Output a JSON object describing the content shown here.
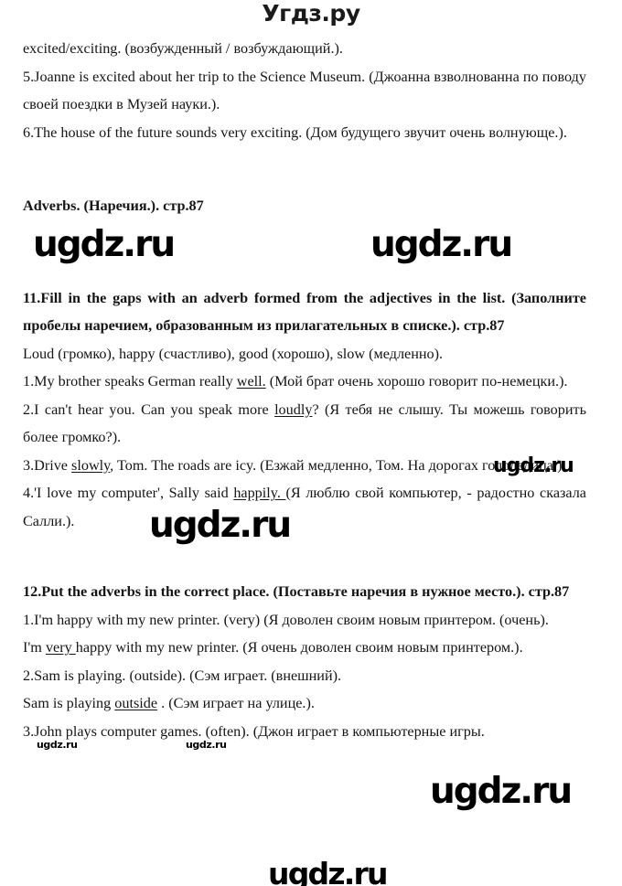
{
  "site": {
    "header_logo": "Угдз.ру",
    "watermark_text": "ugdz.ru"
  },
  "page": {
    "page_reference": "стр.87"
  },
  "watermarks": [
    {
      "id": "wm1",
      "text": "ugdz.ru",
      "size": "xl"
    },
    {
      "id": "wm2",
      "text": "ugdz.ru",
      "size": "xl"
    },
    {
      "id": "wm3",
      "text": "ugdz.ru",
      "size": "md"
    },
    {
      "id": "wm4",
      "text": "ugdz.ru",
      "size": "xl"
    },
    {
      "id": "wm5",
      "text": "ugdz.ru",
      "size": "sm"
    },
    {
      "id": "wm6",
      "text": "ugdz.ru",
      "size": "sm"
    },
    {
      "id": "wm7",
      "text": "ugdz.ru",
      "size": "xl"
    },
    {
      "id": "wm8",
      "text": "ugdz.ru",
      "size": "lg"
    }
  ],
  "content": {
    "intro_line": "excited/exciting. (возбужденный / возбуждающий.).",
    "ex10_items": [
      "5.Joanne is excited about her trip to the Science Museum. (Джоанна взволнованна по поводу своей поездки в Музей науки.).",
      "6.The house of the future sounds very exciting. (Дом будущего звучит очень волнующе.)."
    ],
    "section_heading": "Adverbs. (Наречия.). стр.87",
    "ex11": {
      "title": "11.Fill in the gaps with an adverb formed from the adjectives in the list. (Заполните пробелы наречием, образованным из прилагательных в списке.). стр.87",
      "word_bank": "Loud (громко), happy (счастливо), good (хорошо), slow (медленно).",
      "items": [
        {
          "before": "1.My brother speaks German really ",
          "answer": "well.",
          "after": " (Мой брат очень хорошо говорит по-немецки.)."
        },
        {
          "before": "2.I can't hear you. Can you speak more ",
          "answer": "loudly",
          "after": "? (Я тебя не слышу. Ты можешь говорить более громко?)."
        },
        {
          "before": "3.Drive ",
          "answer": "slowly",
          "after": ", Tom. The roads are icy. (Езжай медленно, Том. На дорогах гололедица.)."
        },
        {
          "before": "4.'I love my computer', Sally said ",
          "answer": "happily. ",
          "after": "(Я люблю свой компьютер, - радостно сказала Салли.)."
        }
      ]
    },
    "ex12": {
      "title": "12.Put the adverbs in the correct place. (Поставьте наречия в нужное место.). стр.87",
      "items": [
        {
          "prompt": "1.I'm happy with my new printer. (very) (Я доволен своим новым принтером. (очень).",
          "answer_before": "I'm ",
          "answer_word": "very ",
          "answer_after": "happy with my new printer. (Я очень доволен своим новым принтером.)."
        },
        {
          "prompt": "2.Sam is playing. (outside). (Сэм играет. (внешний).",
          "answer_before": "Sam is playing ",
          "answer_word": "outside",
          "answer_after": " . (Сэм играет на улице.)."
        },
        {
          "prompt": "3.John plays computer games. (often). (Джон играет в компьютерные игры.",
          "answer_before": "",
          "answer_word": "",
          "answer_after": ""
        }
      ]
    }
  }
}
